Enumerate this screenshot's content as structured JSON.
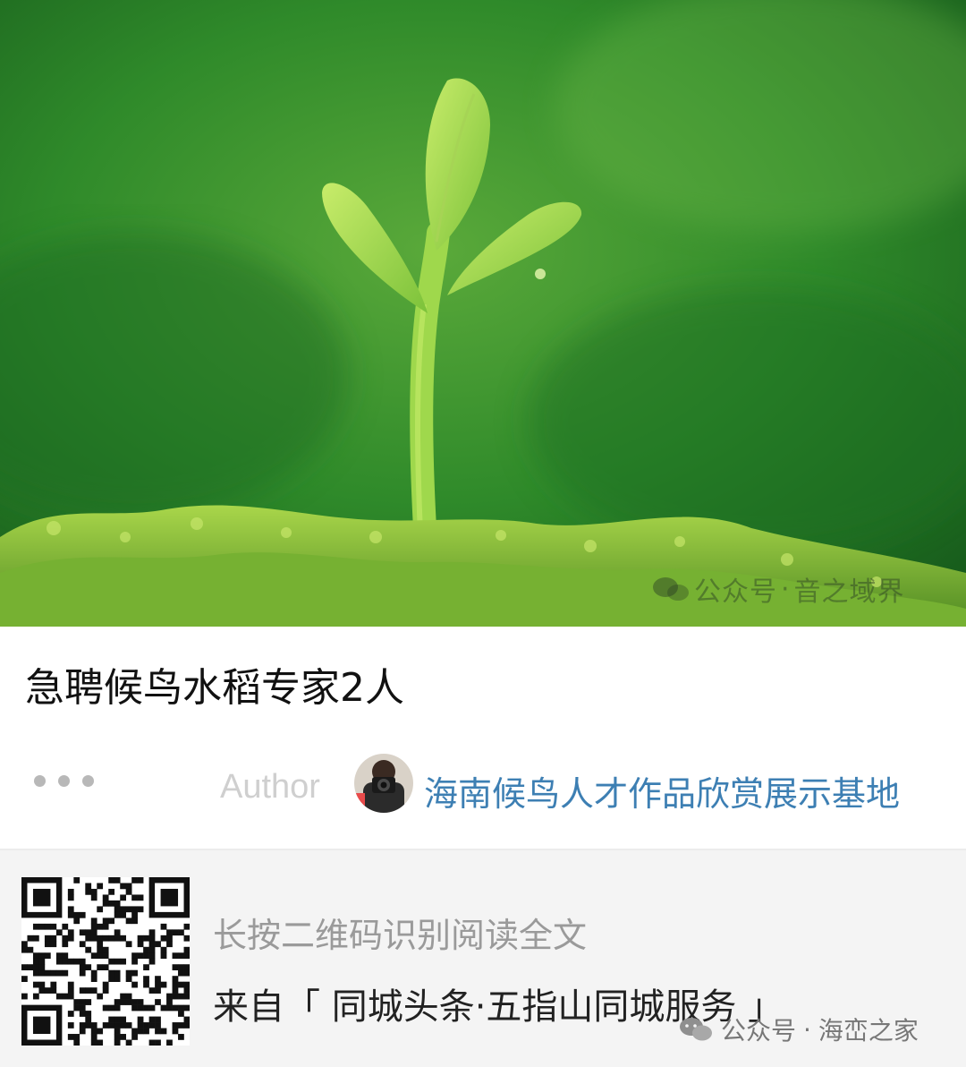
{
  "hero": {
    "image_description": "green seedling sprouting from moss",
    "watermark_prefix": "公众号",
    "watermark_name": "音之域界"
  },
  "article": {
    "title": "急聘候鸟水稻专家2人"
  },
  "author": {
    "label": "Author",
    "name": "海南候鸟人才作品欣赏展示基地"
  },
  "footer": {
    "qr_hint": "长按二维码识别阅读全文",
    "source_prefix": "来自",
    "source_open": "「",
    "source_name": "同城头条·五指山同城服务",
    "source_close": "」",
    "account_mark_prefix": "公众号",
    "account_mark_sep": "·",
    "account_mark_name": "海峦之家"
  },
  "colors": {
    "title": "#111111",
    "author_link": "#3d7fb3",
    "muted": "#9a9a9a",
    "footer_bg": "#f4f4f4"
  },
  "icons": [
    "wechat-logo-icon",
    "more-dots-icon",
    "qr-code-icon",
    "avatar"
  ]
}
